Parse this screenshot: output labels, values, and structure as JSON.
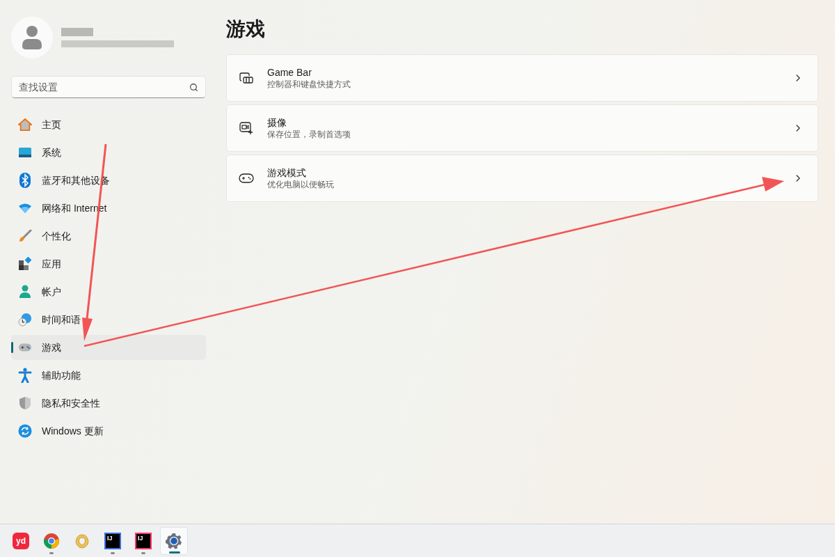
{
  "sidebar": {
    "search": {
      "placeholder": "查找设置"
    },
    "items": [
      {
        "label": "主页",
        "selected": false
      },
      {
        "label": "系统",
        "selected": false
      },
      {
        "label": "蓝牙和其他设备",
        "selected": false
      },
      {
        "label": "网络和 Internet",
        "selected": false
      },
      {
        "label": "个性化",
        "selected": false
      },
      {
        "label": "应用",
        "selected": false
      },
      {
        "label": "帐户",
        "selected": false
      },
      {
        "label": "时间和语",
        "selected": false
      },
      {
        "label": "游戏",
        "selected": true
      },
      {
        "label": "辅助功能",
        "selected": false
      },
      {
        "label": "隐私和安全性",
        "selected": false
      },
      {
        "label": "Windows 更新",
        "selected": false
      }
    ]
  },
  "page": {
    "title": "游戏",
    "cards": [
      {
        "title": "Game Bar",
        "subtitle": "控制器和键盘快捷方式"
      },
      {
        "title": "摄像",
        "subtitle": "保存位置，录制首选项"
      },
      {
        "title": "游戏模式",
        "subtitle": "优化电脑以便畅玩"
      }
    ]
  },
  "taskbar": [
    {
      "label": "yd",
      "running": false,
      "active": false
    },
    {
      "running": true,
      "active": false
    },
    {
      "running": false,
      "active": false
    },
    {
      "label": "IJ",
      "running": true,
      "active": false
    },
    {
      "label": "IJ",
      "running": true,
      "active": false
    },
    {
      "running": true,
      "active": true
    }
  ]
}
